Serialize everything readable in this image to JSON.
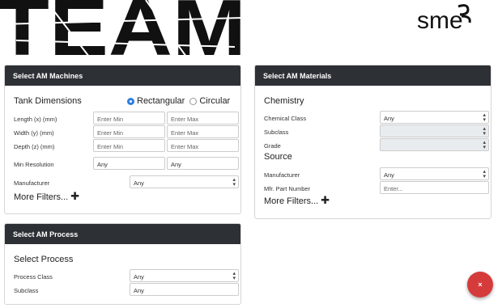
{
  "logos": {
    "team": "TEAM",
    "sme": "sme"
  },
  "machines": {
    "header": "Select AM Machines",
    "tank_title": "Tank Dimensions",
    "radio_rect": "Rectangular",
    "radio_circ": "Circular",
    "length_label": "Length (x) (mm)",
    "width_label": "Width (y) (mm)",
    "depth_label": "Depth (z) (mm)",
    "min_placeholder": "Enter Min",
    "max_placeholder": "Enter Max",
    "minres_label": "Min Resolution",
    "minres_min": "Any",
    "minres_max": "Any",
    "manufacturer_label": "Manufacturer",
    "manufacturer_value": "Any",
    "more_filters": "More Filters..."
  },
  "materials": {
    "header": "Select AM Materials",
    "chemistry_title": "Chemistry",
    "chem_class_label": "Chemical Class",
    "chem_class_value": "Any",
    "subclass_label": "Subclass",
    "grade_label": "Grade",
    "source_title": "Source",
    "manufacturer_label": "Manufacturer",
    "manufacturer_value": "Any",
    "part_label": "Mfr. Part Number",
    "part_placeholder": "Enter...",
    "more_filters": "More Filters..."
  },
  "process": {
    "header": "Select AM Process",
    "title": "Select Process",
    "class_label": "Process Class",
    "class_value": "Any",
    "subclass_label": "Subclass",
    "subclass_value": "Any"
  },
  "close_button": "×",
  "colors": {
    "header_bg": "#2d3035",
    "accent": "#2f7fe0",
    "close_bg": "#d63b3b"
  }
}
